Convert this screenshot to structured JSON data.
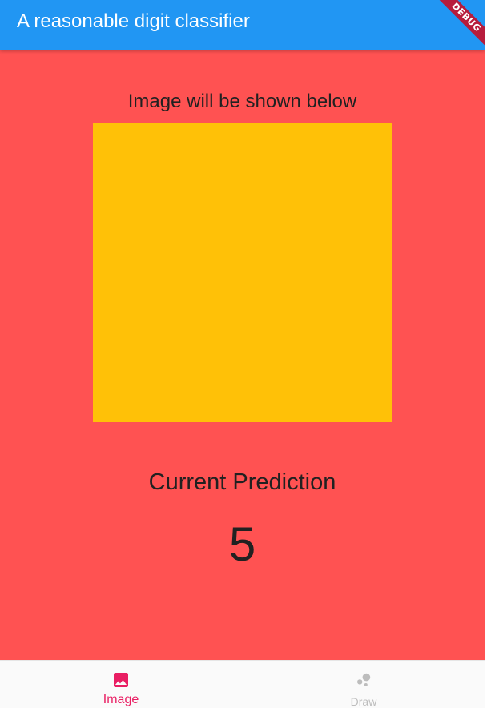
{
  "appbar": {
    "title": "A reasonable digit classifier",
    "color": "#2196F3"
  },
  "debug_banner": {
    "label": "DEBUG",
    "color": "#B71C3C"
  },
  "main": {
    "background_color": "#FF5252",
    "caption": "Image will be shown below",
    "image_placeholder_color": "#FFC107",
    "prediction_title": "Current Prediction",
    "prediction_value": "5"
  },
  "bottom_nav": {
    "active_color": "#E91E63",
    "inactive_color": "#BDBDBD",
    "items": [
      {
        "label": "Image",
        "icon": "image-icon",
        "active": true
      },
      {
        "label": "Draw",
        "icon": "bubble-chart-icon",
        "active": false
      }
    ]
  }
}
